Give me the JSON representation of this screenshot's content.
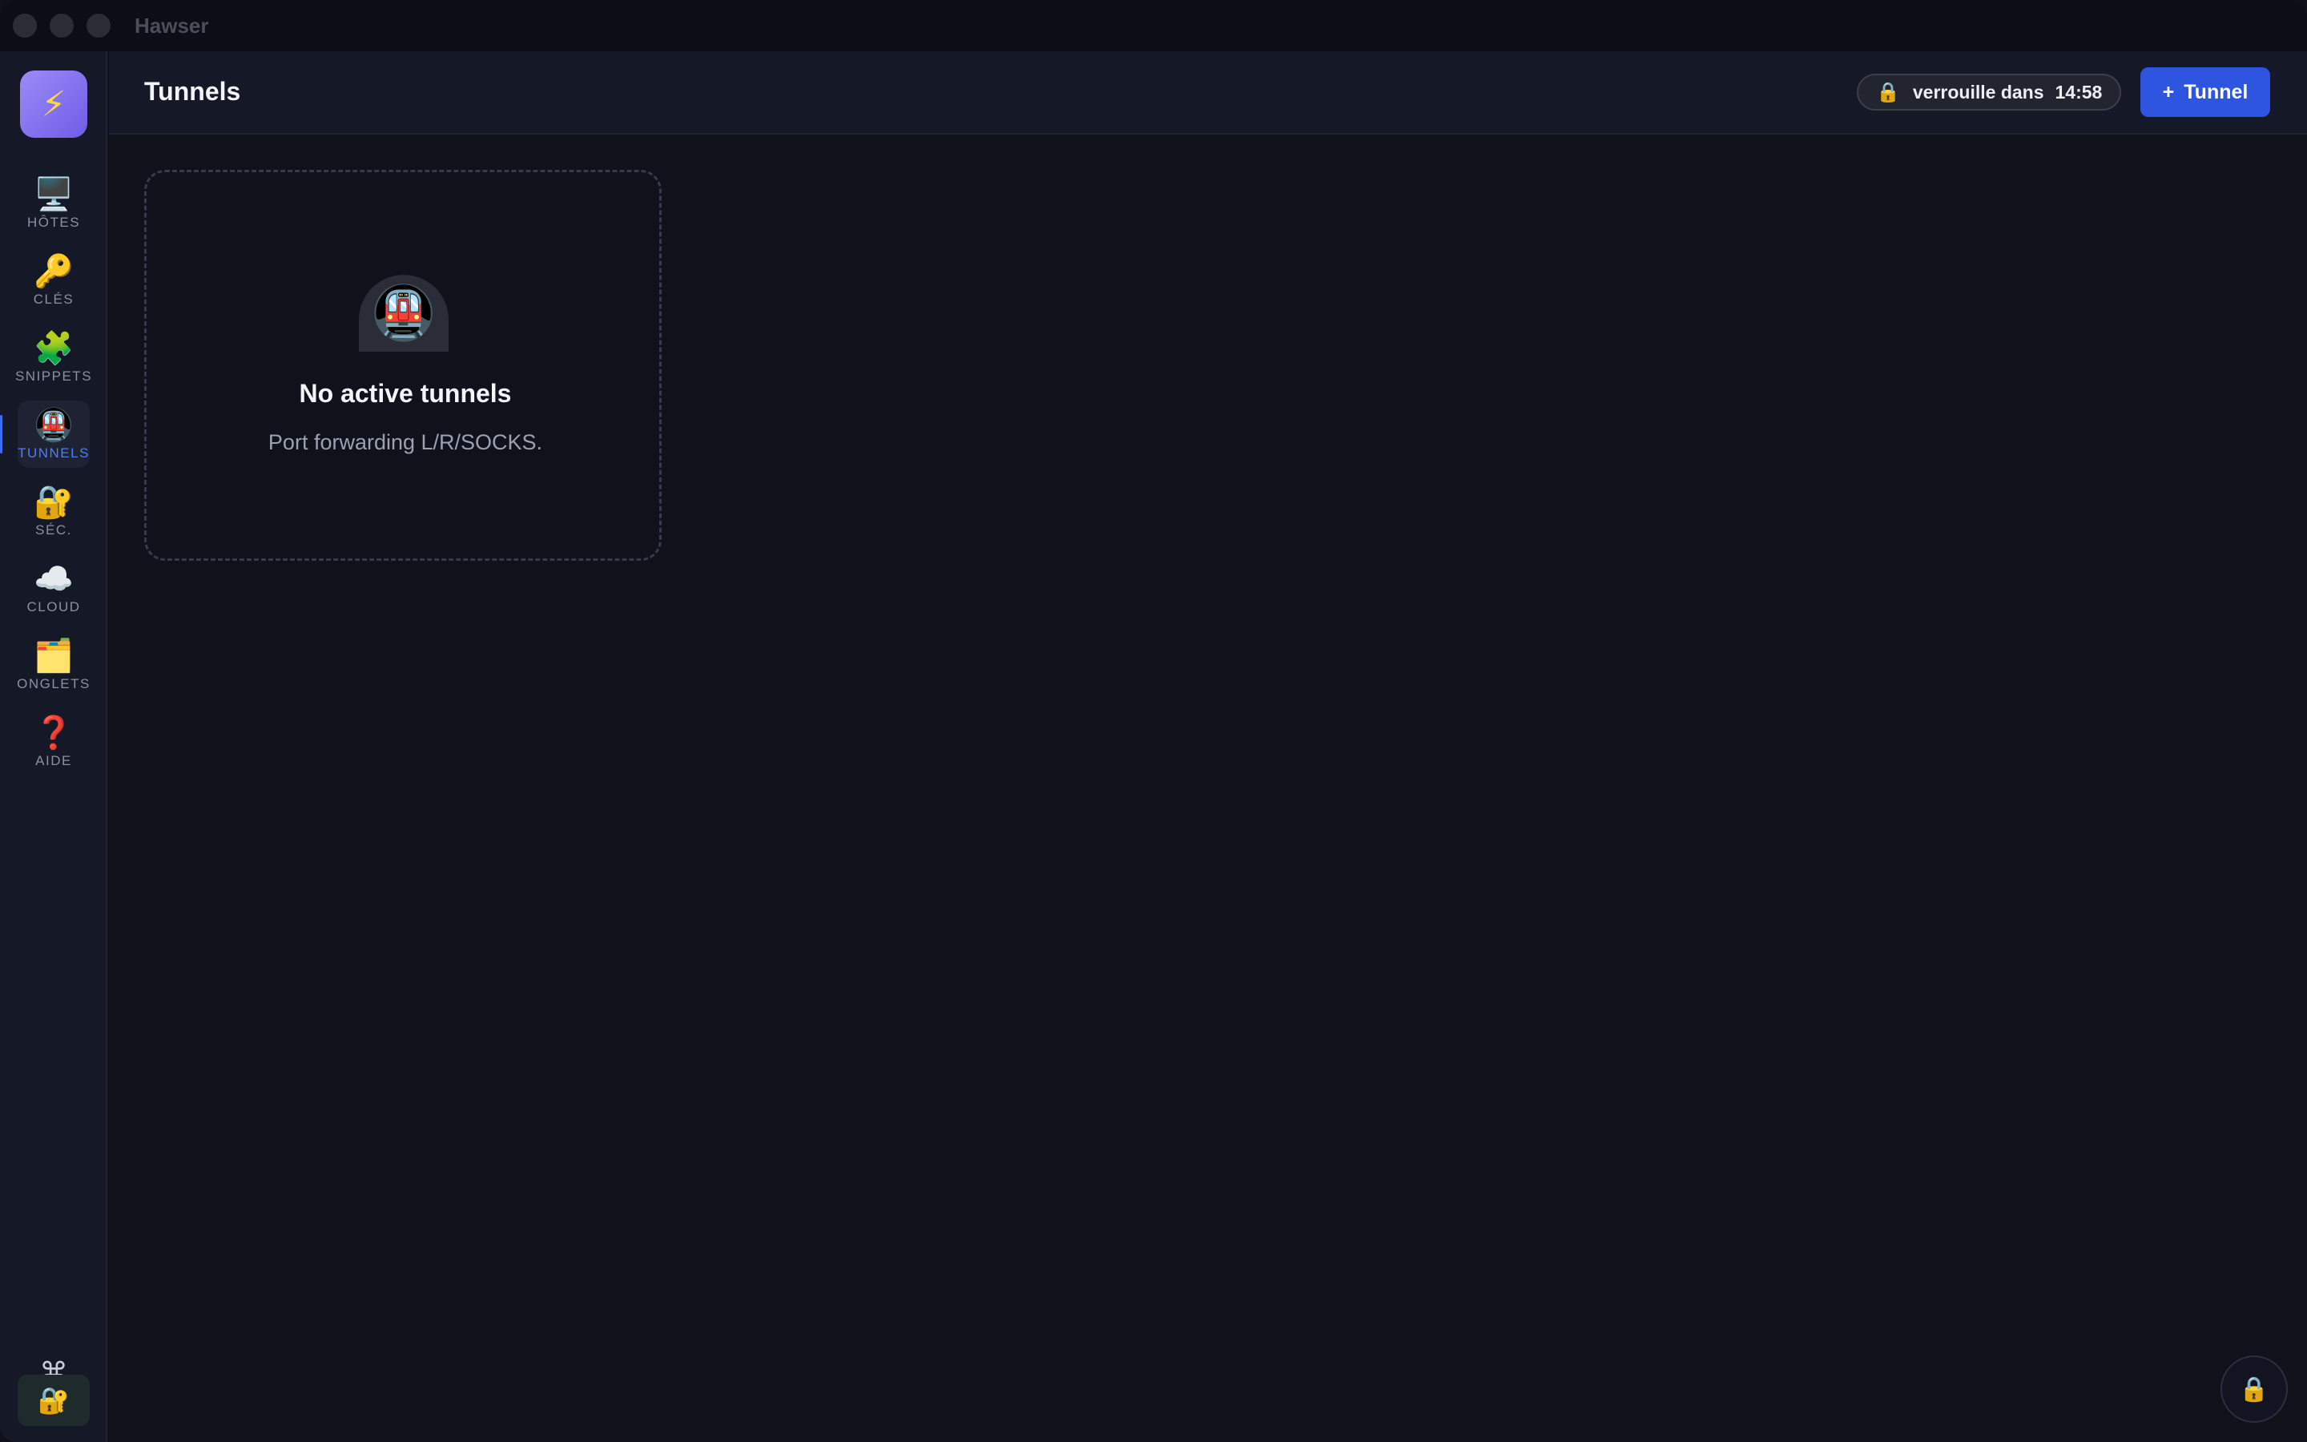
{
  "window": {
    "title": "Hawser"
  },
  "sidebar": {
    "logo_icon": "lightning-icon",
    "items": [
      {
        "label": "HÔTES",
        "icon": "🖥️",
        "icon_name": "desktop-computer-icon",
        "active": false
      },
      {
        "label": "CLÉS",
        "icon": "🔑",
        "icon_name": "key-icon",
        "active": false
      },
      {
        "label": "SNIPPETS",
        "icon": "🧩",
        "icon_name": "puzzle-piece-icon",
        "active": false
      },
      {
        "label": "TUNNELS",
        "icon": "🚇",
        "icon_name": "metro-icon",
        "active": true
      },
      {
        "label": "SÉC.",
        "icon": "🔐",
        "icon_name": "locked-with-key-icon",
        "active": false
      },
      {
        "label": "CLOUD",
        "icon": "☁️",
        "icon_name": "cloud-icon",
        "active": false
      },
      {
        "label": "ONGLETS",
        "icon": "🗂️",
        "icon_name": "card-index-dividers-icon",
        "active": false
      },
      {
        "label": "AIDE",
        "icon": "❓",
        "icon_name": "question-mark-icon",
        "active": false
      }
    ],
    "command_symbol": "⌘",
    "command_label": "⌘K",
    "lock_icon": "🔐"
  },
  "header": {
    "title": "Tunnels",
    "lock_timer": {
      "icon": "🔒",
      "label": "verrouille dans",
      "time": "14:58"
    },
    "add_button": {
      "plus": "+",
      "label": "Tunnel"
    }
  },
  "empty_state": {
    "icon": "🚇",
    "title": "No active tunnels",
    "subtitle": "Port forwarding L/R/SOCKS."
  },
  "floating_lock_icon": "🔒",
  "colors": {
    "accent": "#2d55e0",
    "active_label": "#4f7df7",
    "background": "#0f111b",
    "sidebar": "#151826"
  }
}
